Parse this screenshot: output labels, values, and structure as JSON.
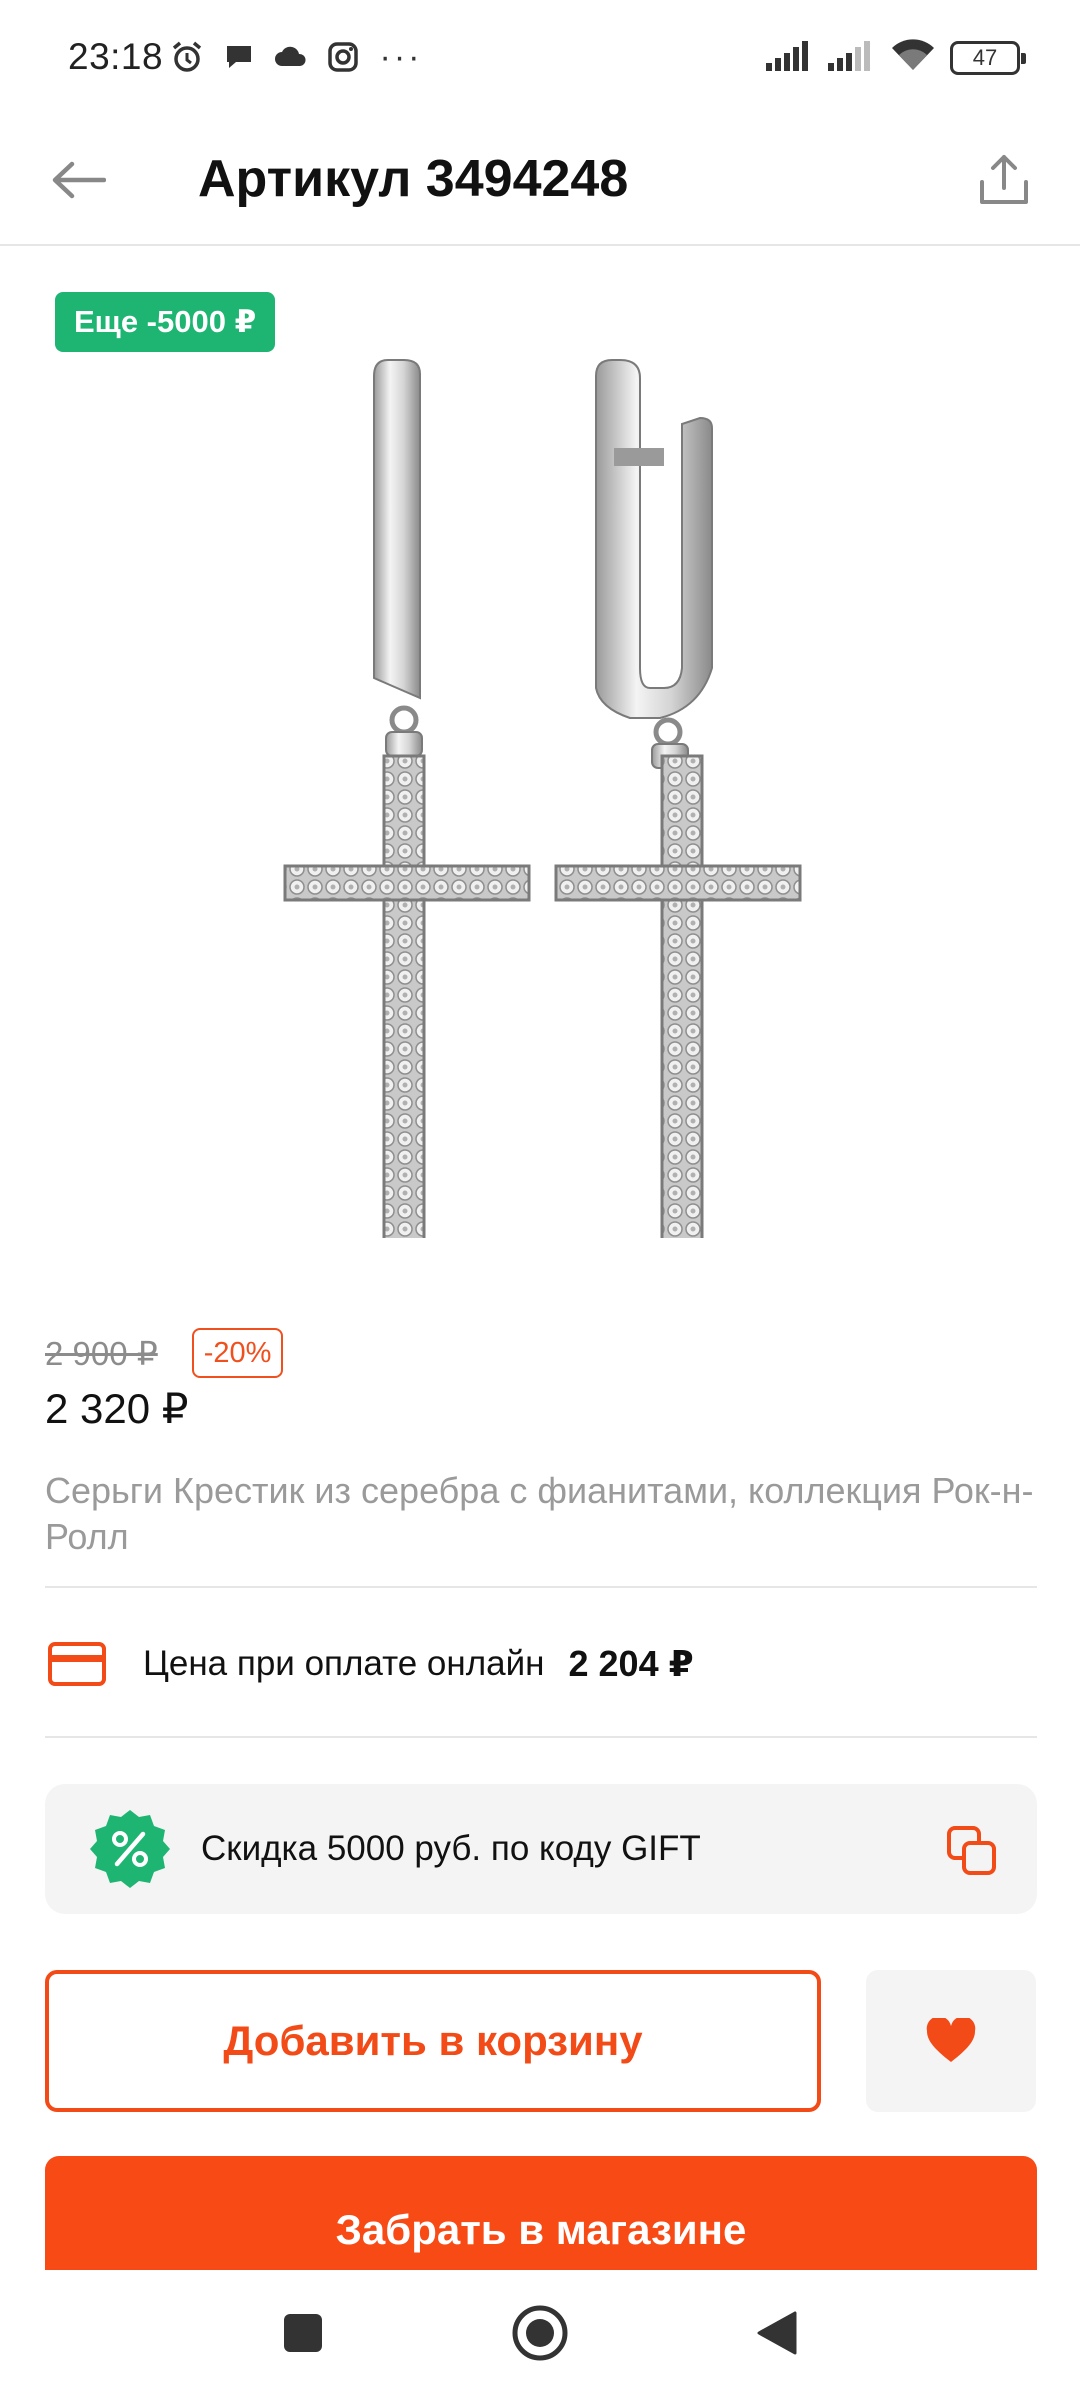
{
  "status_bar": {
    "time": "23:18",
    "battery": "47",
    "left_icons": [
      "alarm-icon",
      "chat-bubble-icon",
      "cloud-icon",
      "instagram-icon"
    ],
    "more": "···",
    "right_icons": [
      "cell-signal-icon",
      "cell-signal-icon",
      "wifi-icon",
      "battery-icon"
    ]
  },
  "header": {
    "title": "Артикул 3494248",
    "back_icon": "arrow-left-icon",
    "share_icon": "share-icon"
  },
  "product": {
    "badge": "Еще -5000 ₽",
    "old_price": "2 900 ₽",
    "discount": "-20%",
    "price": "2 320 ₽",
    "name": "Серьги Крестик из серебра с фианитами, коллекция Рок-н-Ролл"
  },
  "online_payment": {
    "icon": "credit-card-icon",
    "label": "Цена при оплате онлайн",
    "price": "2 204 ₽"
  },
  "promo": {
    "icon": "percent-badge-icon",
    "text": "Скидка 5000 руб. по коду GIFT",
    "copy_icon": "copy-icon"
  },
  "actions": {
    "add_to_cart": "Добавить в корзину",
    "favorite_icon": "heart-icon",
    "pickup": "Забрать в магазине"
  },
  "nav": {
    "recents_icon": "square-icon",
    "home_icon": "circle-icon",
    "back_icon": "triangle-back-icon"
  },
  "colors": {
    "accent": "#f24b17",
    "green": "#1eb572",
    "muted": "#9a9a9a"
  }
}
